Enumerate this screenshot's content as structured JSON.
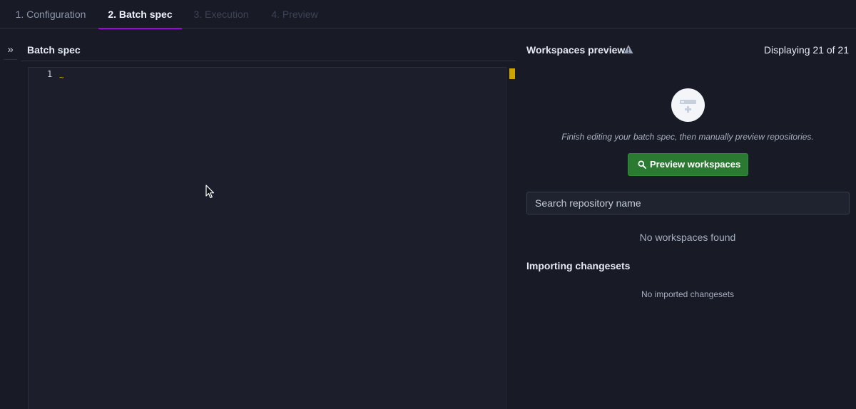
{
  "tabs": [
    {
      "label": "1. Configuration",
      "state": "done"
    },
    {
      "label": "2. Batch spec",
      "state": "active"
    },
    {
      "label": "3. Execution",
      "state": "disabled"
    },
    {
      "label": "4. Preview",
      "state": "disabled"
    }
  ],
  "collapse_glyph": "»",
  "editor": {
    "title": "Batch spec",
    "line_numbers": [
      "1"
    ],
    "squiggle": "~"
  },
  "workspaces": {
    "title": "Workspaces preview",
    "warning_icon": "warning-triangle-icon",
    "count_label": "Displaying 21 of 21",
    "empty_message": "Finish editing your batch spec, then manually preview repositories.",
    "preview_button": "Preview workspaces",
    "search_placeholder": "Search repository name",
    "no_results": "No workspaces found"
  },
  "changesets": {
    "title": "Importing changesets",
    "empty": "No imported changesets"
  },
  "colors": {
    "accent": "#a305e1",
    "button": "#2a7a31",
    "warning_marker": "#cfa400"
  }
}
